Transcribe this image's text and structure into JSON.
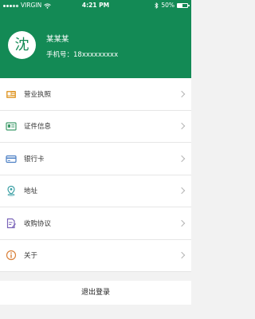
{
  "status_bar": {
    "carrier": "VIRGIN",
    "time": "4:21 PM",
    "battery_pct": "50%",
    "battery_level": 0.5
  },
  "profile": {
    "avatar_char": "沈",
    "name": "某某某",
    "phone_label": "手机号：",
    "phone": "18xxxxxxxxx"
  },
  "menu": {
    "items": [
      {
        "label": "营业执照",
        "icon": "license-icon"
      },
      {
        "label": "证件信息",
        "icon": "id-card-icon"
      },
      {
        "label": "银行卡",
        "icon": "bank-card-icon"
      },
      {
        "label": "地址",
        "icon": "location-icon"
      },
      {
        "label": "收购协议",
        "icon": "agreement-icon"
      },
      {
        "label": "关于",
        "icon": "info-icon"
      }
    ]
  },
  "logout_label": "退出登录",
  "colors": {
    "brand": "#138a55",
    "icon_orange": "#e2a03a",
    "icon_green": "#3f9b6a",
    "icon_blue": "#4b7fc4",
    "icon_teal": "#3a9fa4",
    "icon_purple": "#7a63b8",
    "icon_red": "#d9813a"
  }
}
